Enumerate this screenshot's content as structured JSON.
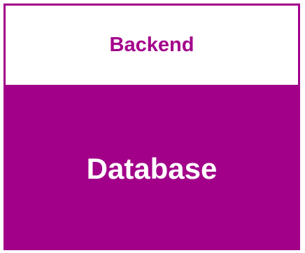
{
  "diagram": {
    "header_label": "Backend",
    "body_label": "Database"
  },
  "colors": {
    "accent": "#a3008a",
    "background": "#ffffff",
    "body_text": "#ffffff"
  }
}
